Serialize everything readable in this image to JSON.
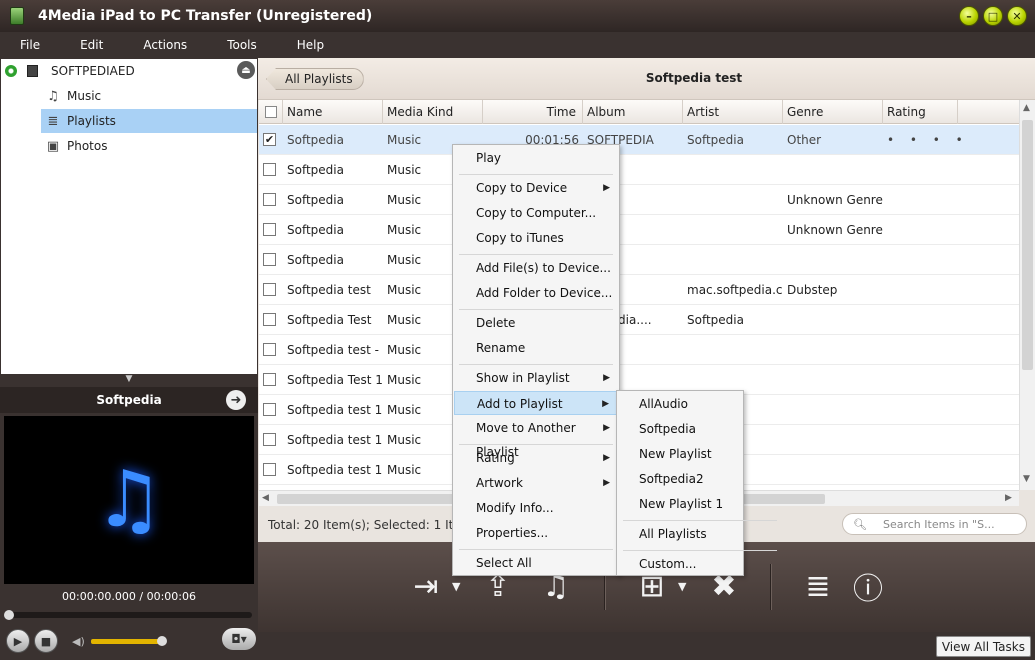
{
  "window": {
    "title": "4Media iPad to PC Transfer (Unregistered)",
    "controls": [
      "minimize",
      "maximize",
      "close"
    ]
  },
  "menubar": [
    "File",
    "Edit",
    "Actions",
    "Tools",
    "Help"
  ],
  "sidebar": {
    "device": "SOFTPEDIAED",
    "items": [
      {
        "label": "Music",
        "icon": "music-icon"
      },
      {
        "label": "Playlists",
        "icon": "playlist-icon",
        "selected": true
      },
      {
        "label": "Photos",
        "icon": "photo-icon"
      }
    ]
  },
  "preview": {
    "title": "Softpedia",
    "timecode": "00:00:00.000 / 00:00:06"
  },
  "main": {
    "back_button": "All Playlists",
    "playlist_title": "Softpedia test",
    "columns": [
      "Name",
      "Media Kind",
      "Time",
      "Album",
      "Artist",
      "Genre",
      "Rating"
    ],
    "rows": [
      {
        "checked": true,
        "name": "Softpedia",
        "kind": "Music",
        "time": "00:01:56",
        "album": "SOFTPEDIA",
        "artist": "Softpedia",
        "genre": "Other",
        "rating": "• • • • •"
      },
      {
        "checked": false,
        "name": "Softpedia",
        "kind": "Music",
        "time": "",
        "album": "",
        "artist": "",
        "genre": "",
        "rating": ""
      },
      {
        "checked": false,
        "name": "Softpedia",
        "kind": "Music",
        "time": "",
        "album": "",
        "artist": "",
        "genre": "Unknown Genre",
        "rating": ""
      },
      {
        "checked": false,
        "name": "Softpedia",
        "kind": "Music",
        "time": "",
        "album": "",
        "artist": "",
        "genre": "Unknown Genre",
        "rating": ""
      },
      {
        "checked": false,
        "name": "Softpedia",
        "kind": "Music",
        "time": "",
        "album": "",
        "artist": "",
        "genre": "",
        "rating": ""
      },
      {
        "checked": false,
        "name": "Softpedia test",
        "kind": "Music",
        "time": "",
        "album": "dia",
        "artist": "mac.softpedia.c...",
        "genre": "Dubstep",
        "rating": ""
      },
      {
        "checked": false,
        "name": "Softpedia Test",
        "kind": "Music",
        "time": "",
        "album": "oftpedia....",
        "artist": "Softpedia",
        "genre": "",
        "rating": ""
      },
      {
        "checked": false,
        "name": "Softpedia test - ...",
        "kind": "Music",
        "time": "",
        "album": "",
        "artist": "",
        "genre": "",
        "rating": ""
      },
      {
        "checked": false,
        "name": "Softpedia Test 1",
        "kind": "Music",
        "time": "",
        "album": "",
        "artist": "",
        "genre": "",
        "rating": ""
      },
      {
        "checked": false,
        "name": "Softpedia test 1...",
        "kind": "Music",
        "time": "",
        "album": "",
        "artist": "",
        "genre": "",
        "rating": ""
      },
      {
        "checked": false,
        "name": "Softpedia test 1...",
        "kind": "Music",
        "time": "",
        "album": "",
        "artist": "",
        "genre": "",
        "rating": ""
      },
      {
        "checked": false,
        "name": "Softpedia test 1...",
        "kind": "Music",
        "time": "",
        "album": "",
        "artist": "",
        "genre": "",
        "rating": ""
      }
    ],
    "status": "Total: 20 Item(s); Selected: 1 Item(s)",
    "search_placeholder": "Search Items in \"S..."
  },
  "context_menu": {
    "items": [
      {
        "label": "Play"
      },
      {
        "sep": true
      },
      {
        "label": "Copy to Device",
        "sub": true
      },
      {
        "label": "Copy to Computer..."
      },
      {
        "label": "Copy to iTunes"
      },
      {
        "sep": true
      },
      {
        "label": "Add File(s) to Device..."
      },
      {
        "label": "Add Folder to Device..."
      },
      {
        "sep": true
      },
      {
        "label": "Delete"
      },
      {
        "label": "Rename"
      },
      {
        "sep": true
      },
      {
        "label": "Show in Playlist",
        "sub": true
      },
      {
        "label": "Add to Playlist",
        "sub": true,
        "highlighted": true
      },
      {
        "label": "Move to Another Playlist",
        "sub": true
      },
      {
        "sep": true
      },
      {
        "label": "Rating",
        "sub": true
      },
      {
        "label": "Artwork",
        "sub": true
      },
      {
        "label": "Modify Info..."
      },
      {
        "label": "Properties..."
      },
      {
        "sep": true
      },
      {
        "label": "Select All"
      }
    ]
  },
  "submenu": {
    "items": [
      {
        "label": "AllAudio"
      },
      {
        "label": "Softpedia"
      },
      {
        "label": "New Playlist"
      },
      {
        "label": "Softpedia2"
      },
      {
        "label": "New Playlist 1"
      },
      {
        "sep": true
      },
      {
        "label": "All Playlists"
      },
      {
        "sep": true
      },
      {
        "label": "Custom..."
      }
    ]
  },
  "toolbar": {
    "buttons": [
      "add-to-device-icon",
      "export-to-pc-icon",
      "itunes-icon",
      "add-video-icon",
      "delete-icon",
      "playlist-icon",
      "device-info-icon"
    ]
  },
  "bottom": {
    "view_all_tasks": "View All Tasks"
  }
}
